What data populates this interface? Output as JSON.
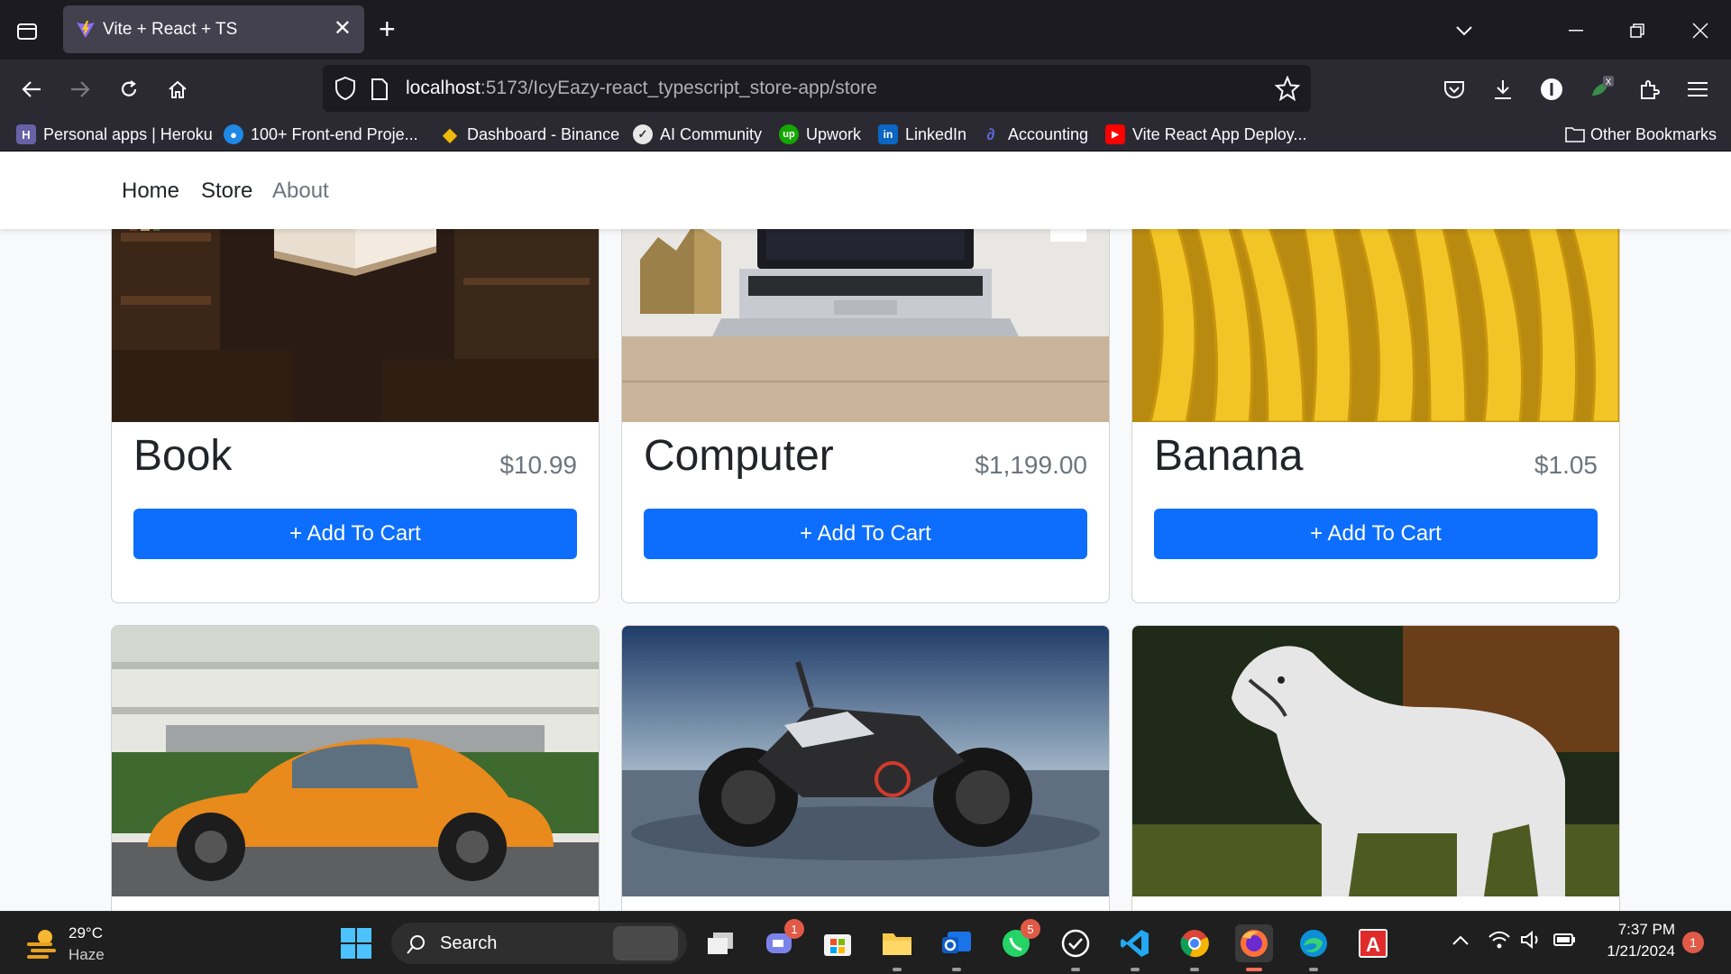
{
  "browser": {
    "tab_title": "Vite + React + TS",
    "url_host": "localhost",
    "url_path": ":5173/IcyEazy-react_typescript_store-app/store",
    "bookmarks": [
      {
        "label": "Personal apps | Heroku",
        "icon": "heroku-icon",
        "color": "#6762a6"
      },
      {
        "label": "100+ Front-end Proje...",
        "icon": "github-icon",
        "color": "#1e88e5"
      },
      {
        "label": "Dashboard - Binance",
        "icon": "binance-icon",
        "color": "#f0b90b"
      },
      {
        "label": "AI Community",
        "icon": "ai-community-icon",
        "color": "#e8e8e8"
      },
      {
        "label": "Upwork",
        "icon": "upwork-icon",
        "color": "#14a800"
      },
      {
        "label": "LinkedIn",
        "icon": "linkedin-icon",
        "color": "#0a66c2"
      },
      {
        "label": "Accounting",
        "icon": "accounting-icon",
        "color": "#5a6bd8"
      },
      {
        "label": "Vite React App Deploy...",
        "icon": "youtube-icon",
        "color": "#ff0000"
      }
    ],
    "other_bookmarks": "Other Bookmarks"
  },
  "nav": {
    "home": "Home",
    "store": "Store",
    "about": "About"
  },
  "store": {
    "items": [
      {
        "name": "Book",
        "price": "$10.99",
        "button": "+ Add To Cart",
        "image": "book-image"
      },
      {
        "name": "Computer",
        "price": "$1,199.00",
        "button": "+ Add To Cart",
        "image": "computer-image"
      },
      {
        "name": "Banana",
        "price": "$1.05",
        "button": "+ Add To Cart",
        "image": "banana-image"
      },
      {
        "image": "car-image"
      },
      {
        "image": "motorcycle-image"
      },
      {
        "image": "horse-image"
      }
    ]
  },
  "taskbar": {
    "weather_temp": "29°C",
    "weather_desc": "Haze",
    "search_label": "Search",
    "time": "7:37 PM",
    "date": "1/21/2024",
    "notification_count": "1",
    "teams_badge": "1",
    "whatsapp_badge": "5"
  },
  "colors": {
    "primary": "#0d6efd",
    "browser_dark": "#1c1b22",
    "toolbar": "#2b2a33"
  }
}
